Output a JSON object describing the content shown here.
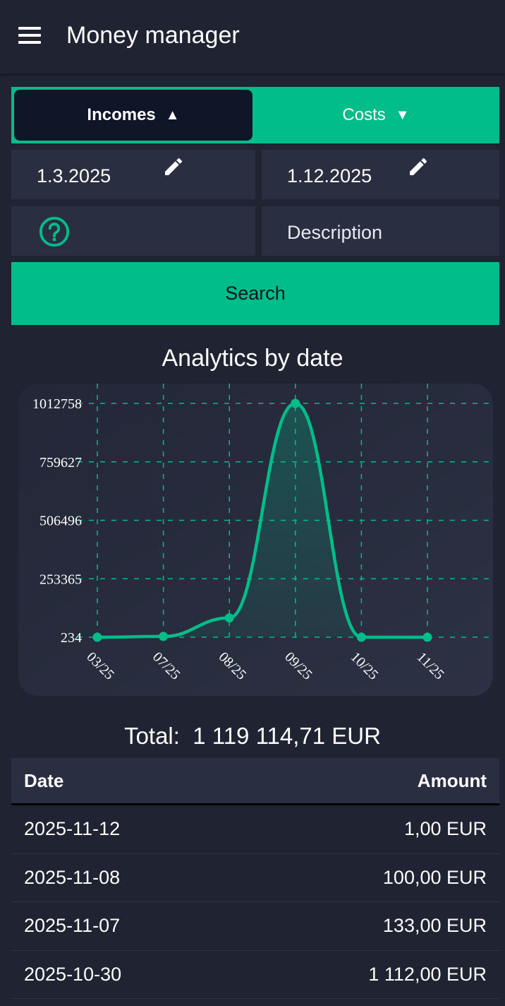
{
  "app": {
    "title": "Money manager"
  },
  "filters": {
    "tabs": [
      {
        "label": "Incomes",
        "arrow": "▲",
        "active": true
      },
      {
        "label": "Costs",
        "arrow": "▼",
        "active": false
      }
    ],
    "date_from": "1.3.2025",
    "date_to": "1.12.2025",
    "category_icon": "help-circle-icon",
    "description_placeholder": "Description",
    "search_label": "Search"
  },
  "analytics": {
    "title": "Analytics by date",
    "chart_data": {
      "type": "area",
      "x": [
        "03/25",
        "07/25",
        "08/25",
        "09/25",
        "10/25",
        "11/25"
      ],
      "values": [
        234,
        3500,
        84000,
        1012758,
        234,
        234
      ],
      "y_ticks": [
        234,
        253365,
        506496,
        759627,
        1012758
      ],
      "ylim": [
        234,
        1012758
      ],
      "grid": true,
      "line_color": "#00bd8a"
    }
  },
  "summary": {
    "total_prefix": "Total:",
    "total_value": "1 119 114,71 EUR"
  },
  "table": {
    "headers": {
      "date": "Date",
      "amount": "Amount"
    },
    "rows": [
      {
        "date": "2025-11-12",
        "amount": "1,00 EUR"
      },
      {
        "date": "2025-11-08",
        "amount": "100,00 EUR"
      },
      {
        "date": "2025-11-07",
        "amount": "133,00 EUR"
      },
      {
        "date": "2025-10-30",
        "amount": "1 112,00 EUR"
      }
    ]
  },
  "colors": {
    "accent": "#00bd8a",
    "background": "#1f2332",
    "panel": "#292e41",
    "active_tab": "#0e1628"
  }
}
